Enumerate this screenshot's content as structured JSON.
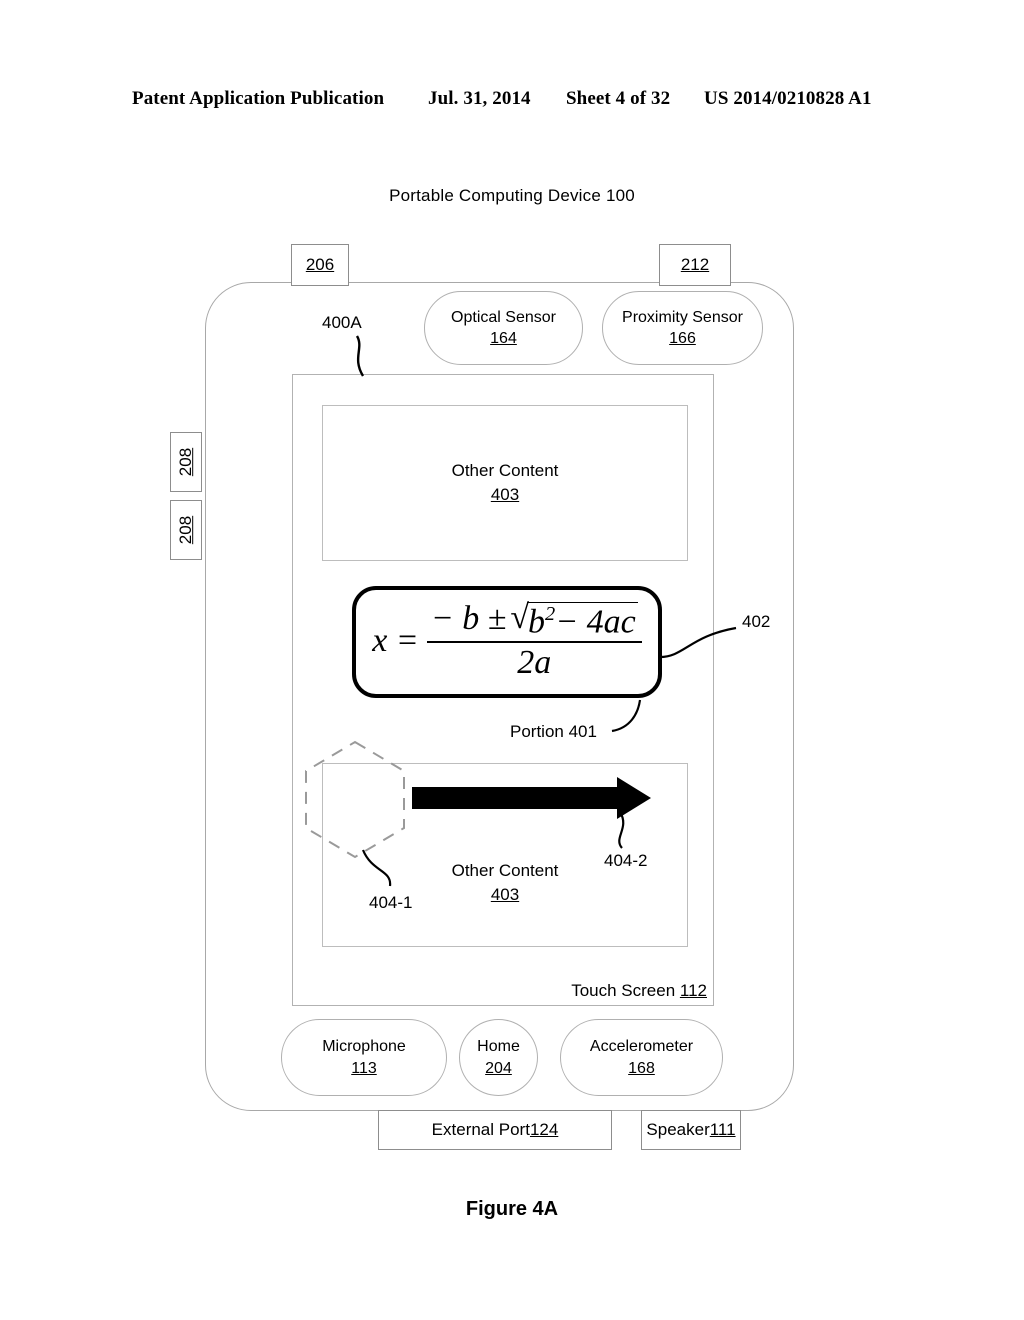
{
  "header": {
    "publication": "Patent Application Publication",
    "date": "Jul. 31, 2014",
    "sheet": "Sheet 4 of 32",
    "number": "US 2014/0210828 A1"
  },
  "figure": {
    "title": "Portable Computing Device 100",
    "caption": "Figure 4A"
  },
  "bezel": {
    "label_206": "206",
    "label_212": "212",
    "label_208_upper": "208",
    "label_208_lower": "208"
  },
  "sensors": {
    "optical": {
      "name": "Optical Sensor",
      "ref": "164"
    },
    "proximity": {
      "name": "Proximity Sensor",
      "ref": "166"
    },
    "microphone": {
      "name": "Microphone",
      "ref": "113"
    },
    "home": {
      "name": "Home",
      "ref": "204"
    },
    "accelerometer": {
      "name": "Accelerometer",
      "ref": "168"
    }
  },
  "touchscreen": {
    "label": "Touch Screen ",
    "ref": "112"
  },
  "content": {
    "top": {
      "label": "Other Content",
      "ref": "403"
    },
    "bottom": {
      "label": "Other Content",
      "ref": "403"
    }
  },
  "formula": {
    "lhs": "x =",
    "numerator_lead": "− b ±",
    "radical_sign": "√",
    "radicand": "b",
    "radicand_exp": "2",
    "radicand_tail": "− 4ac",
    "denominator": "2a",
    "plain": "x = (-b ± √(b² - 4ac)) / 2a"
  },
  "refs": {
    "view": "400A",
    "magnified_box": "402",
    "portion": "Portion 401",
    "contact_start": "404-1",
    "contact_end": "404-2"
  },
  "ports": {
    "external": {
      "label": "External Port ",
      "ref": "124"
    },
    "speaker": {
      "label": "Speaker ",
      "ref": "111"
    }
  },
  "colors": {
    "line_gray": "#b0b0b0",
    "line_dark": "#000000",
    "background": "#ffffff"
  }
}
